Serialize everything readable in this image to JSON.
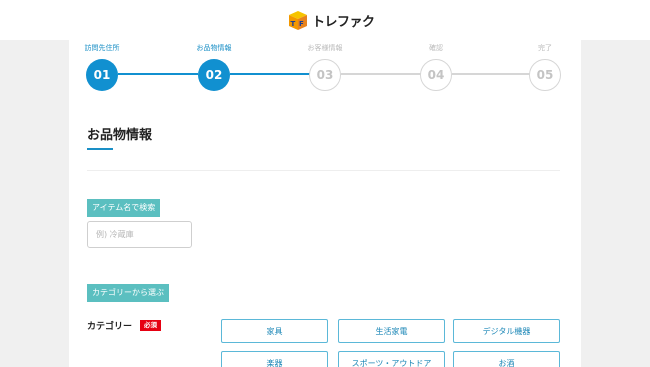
{
  "header": {
    "logo_text": "トレファク"
  },
  "steps": [
    {
      "label": "訪問先住所",
      "number": "01",
      "state": "done"
    },
    {
      "label": "お品物情報",
      "number": "02",
      "state": "done"
    },
    {
      "label": "お客様情報",
      "number": "03",
      "state": "todo"
    },
    {
      "label": "確認",
      "number": "04",
      "state": "todo"
    },
    {
      "label": "完了",
      "number": "05",
      "state": "todo"
    }
  ],
  "section": {
    "title": "お品物情報"
  },
  "search": {
    "tag": "アイテム名で検索",
    "placeholder": "例) 冷蔵庫"
  },
  "category_select": {
    "tag": "カテゴリーから選ぶ"
  },
  "category_field": {
    "label": "カテゴリー",
    "required_badge": "必須"
  },
  "categories": [
    "家具",
    "生活家電",
    "デジタル機器",
    "楽器",
    "スポーツ・アウトドア",
    "お酒"
  ],
  "colors": {
    "accent": "#1190d0",
    "tag_bg": "#5bbfc0",
    "required": "#e60012",
    "button_border": "#5bb8d8"
  }
}
